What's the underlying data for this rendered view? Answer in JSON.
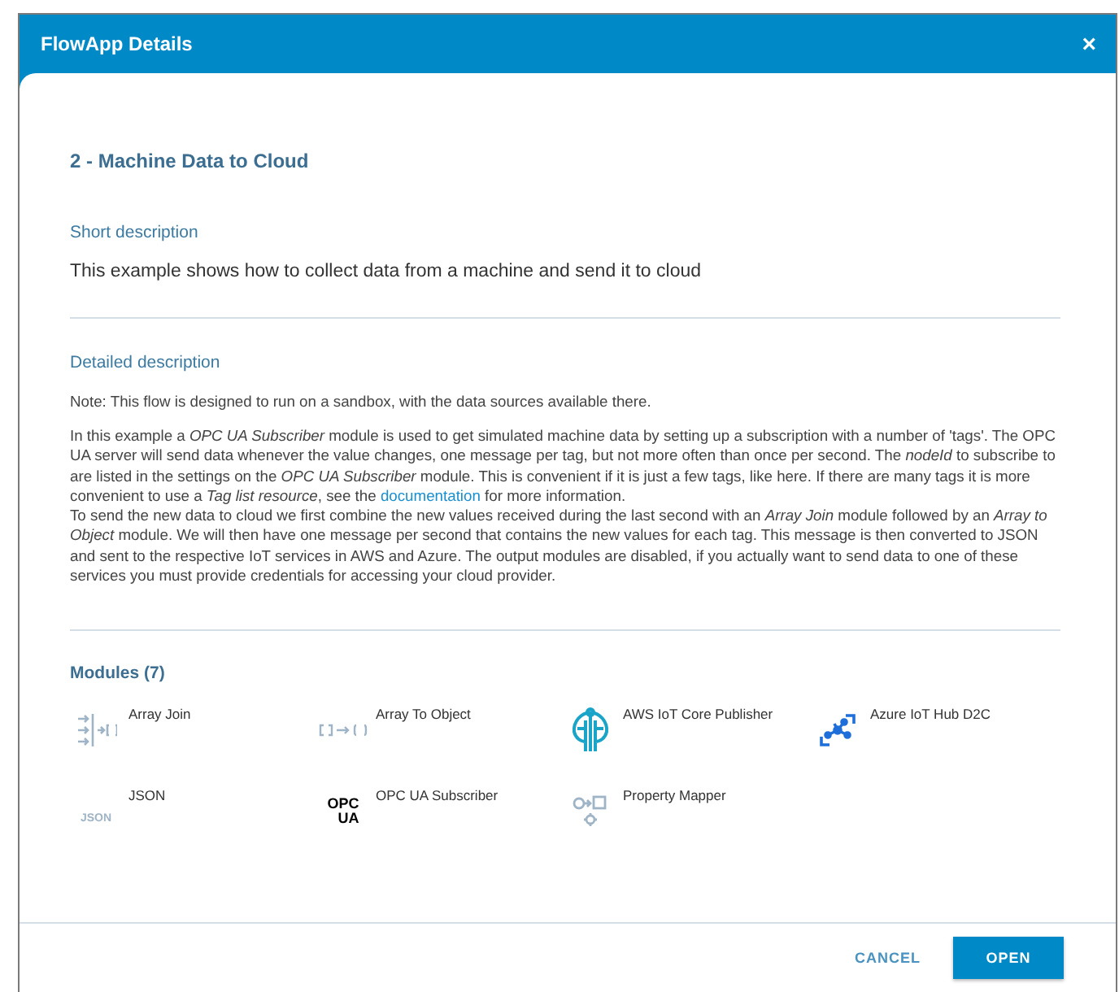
{
  "dialog": {
    "title": "FlowApp Details",
    "close": "×"
  },
  "flow_title": "2 - Machine Data to Cloud",
  "short_description": {
    "label": "Short description",
    "text": "This example shows how to collect data from a machine and send it to cloud"
  },
  "detailed_description": {
    "label": "Detailed description",
    "note": "Note: This flow is designed to run on a sandbox, with the data sources available there.",
    "paragraph": [
      {
        "kind": "text",
        "text": "In this example a *OPC UA Subscriber* module is used to get simulated machine data by setting up a subscription with a number of 'tags'. The OPC UA server will send data whenever the value changes, one message per tag, but not more often than once per second. The *nodeId* to subscribe to are listed in the settings on the *OPC UA Subscriber* module. This is convenient if it is just a few tags, like here. If there are many tags it is more convenient to use a *Tag list resource*, see the "
      },
      {
        "kind": "link",
        "text": "documentation"
      },
      {
        "kind": "text",
        "text": " for more information."
      }
    ],
    "paragraph_2": "To send the new data to cloud we first combine the new values received during the last second with an *Array Join* module followed by an *Array to Object* module. We will then have one message per second that contains the new values for each tag. This message is then converted to JSON and sent to the respective IoT services in AWS and Azure. The output modules are disabled, if you actually want to send data to one of these services you must provide credentials for accessing your cloud provider."
  },
  "modules": {
    "label": "Modules (7)",
    "items": [
      {
        "name": "Array Join",
        "kind": "join"
      },
      {
        "name": "Array To Object",
        "kind": "to-object"
      },
      {
        "name": "AWS IoT Core Publisher",
        "kind": "aws"
      },
      {
        "name": "Azure IoT Hub D2C",
        "kind": "azure"
      },
      {
        "name": "JSON",
        "kind": "json",
        "icon_text": "JSON"
      },
      {
        "name": "OPC UA Subscriber",
        "kind": "opc",
        "icon_text": [
          "OPC",
          "UA"
        ]
      },
      {
        "name": "Property Mapper",
        "kind": "mapper"
      }
    ]
  },
  "buttons": [
    {
      "label": "CANCEL",
      "kind": "flat"
    },
    {
      "label": "OPEN",
      "kind": "primary"
    }
  ]
}
